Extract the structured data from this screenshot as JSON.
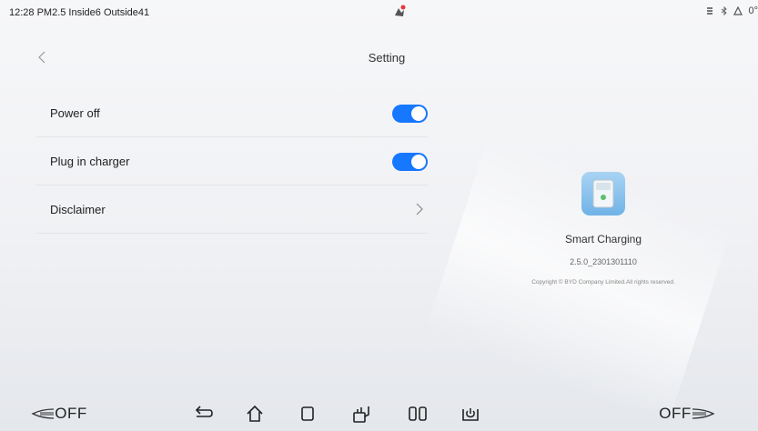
{
  "status_bar": {
    "left_text": "12:28 PM2.5 Inside6 Outside41",
    "right_text": "0°",
    "icons": [
      "notification-icon",
      "wifi-icon",
      "bluetooth-icon",
      "temperature-icon"
    ]
  },
  "header": {
    "title": "Setting",
    "back_icon": "chevron-left-icon"
  },
  "settings": {
    "items": [
      {
        "label": "Power off",
        "type": "toggle",
        "enabled": true
      },
      {
        "label": "Plug in charger",
        "type": "toggle",
        "enabled": true
      },
      {
        "label": "Disclaimer",
        "type": "link"
      }
    ]
  },
  "app_info": {
    "name": "Smart Charging",
    "version": "2.5.0_2301301110",
    "copyright": "Copyright © BYD Company Limited.All rights reserved."
  },
  "navbar": {
    "left_label": "OFF",
    "right_label": "OFF",
    "icons": [
      "back-icon",
      "home-icon",
      "recents-icon",
      "multi-window-icon",
      "split-screen-icon",
      "power-icon"
    ]
  },
  "colors": {
    "accent": "#1677ff",
    "background": "#f2f3f5"
  }
}
